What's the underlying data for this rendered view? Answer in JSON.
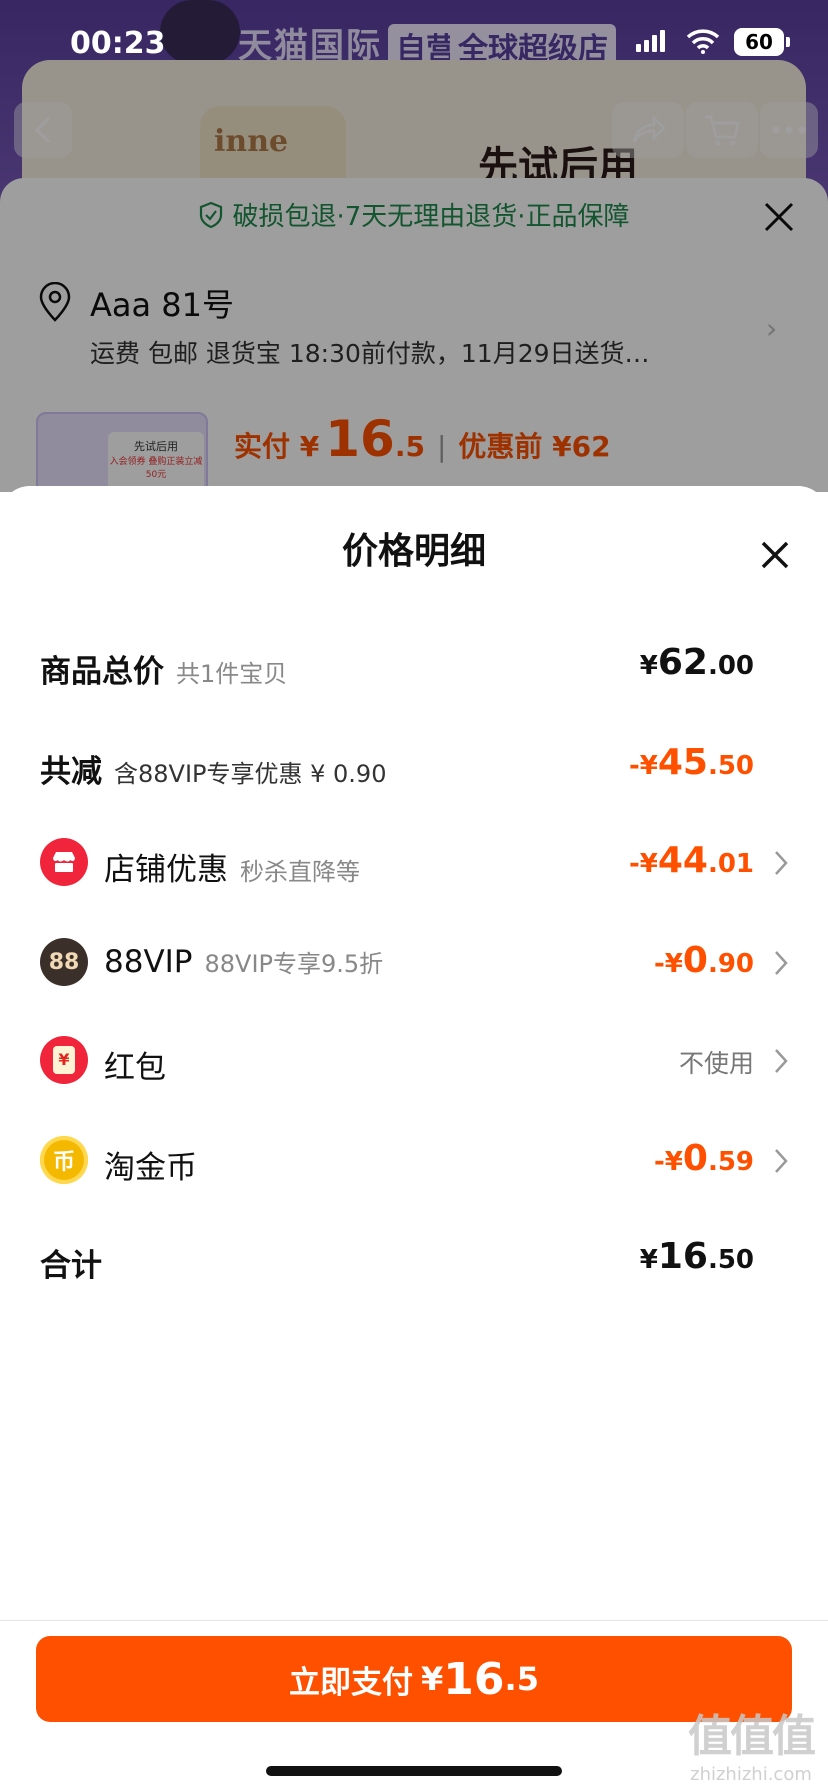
{
  "status_bar": {
    "time": "00:23",
    "battery": "60"
  },
  "background": {
    "banner_text": "天猫国际",
    "banner_tag_1": "自营",
    "banner_tag_2": "全球超级店",
    "product_label": "inne",
    "headline": "先试后用",
    "guarantee": "破损包退·7天无理由退货·正品保障",
    "address_name": "Aaa 81号",
    "shipping": "运费 包邮 退货宝 18:30前付款，11月29日送货…",
    "thumb_title": "先试后用",
    "thumb_sub": "入会领券 叠购正装立减50元",
    "paid_label": "实付 ¥",
    "paid_int": "16",
    "paid_dec": ".5",
    "before_label": "优惠前 ¥62"
  },
  "sheet": {
    "title": "价格明细",
    "rows": {
      "total": {
        "label": "商品总价",
        "sub": "共1件宝贝",
        "cur": "¥",
        "int": "62",
        "dec": ".00"
      },
      "reduce": {
        "label": "共减",
        "sub": "含88VIP专享优惠 ¥ 0.90",
        "cur": "-¥",
        "int": "45",
        "dec": ".50"
      },
      "shop": {
        "label": "店铺优惠",
        "sub": "秒杀直降等",
        "cur": "-¥",
        "int": "44",
        "dec": ".01"
      },
      "vip": {
        "label": "88VIP",
        "sub": "88VIP专享9.5折",
        "cur": "-¥",
        "int": "0",
        "dec": ".90",
        "icon_text": "88"
      },
      "redpacket": {
        "label": "红包",
        "value": "不使用",
        "icon_text": "¥"
      },
      "coin": {
        "label": "淘金币",
        "cur": "-¥",
        "int": "0",
        "dec": ".59",
        "icon_text": "币"
      },
      "sum": {
        "label": "合计",
        "cur": "¥",
        "int": "16",
        "dec": ".50"
      }
    }
  },
  "pay_button": {
    "label": "立即支付",
    "cur": "¥",
    "int": "16",
    "dec": ".5"
  },
  "watermark": {
    "big": "值值值",
    "small": "zhizhizhi.com"
  },
  "colors": {
    "accent": "#ff5000",
    "guarantee_green": "#1f8a4c",
    "shop_icon": "#f0243a",
    "vip_icon": "#3b2f2a",
    "coin_icon": "#f5b800"
  }
}
